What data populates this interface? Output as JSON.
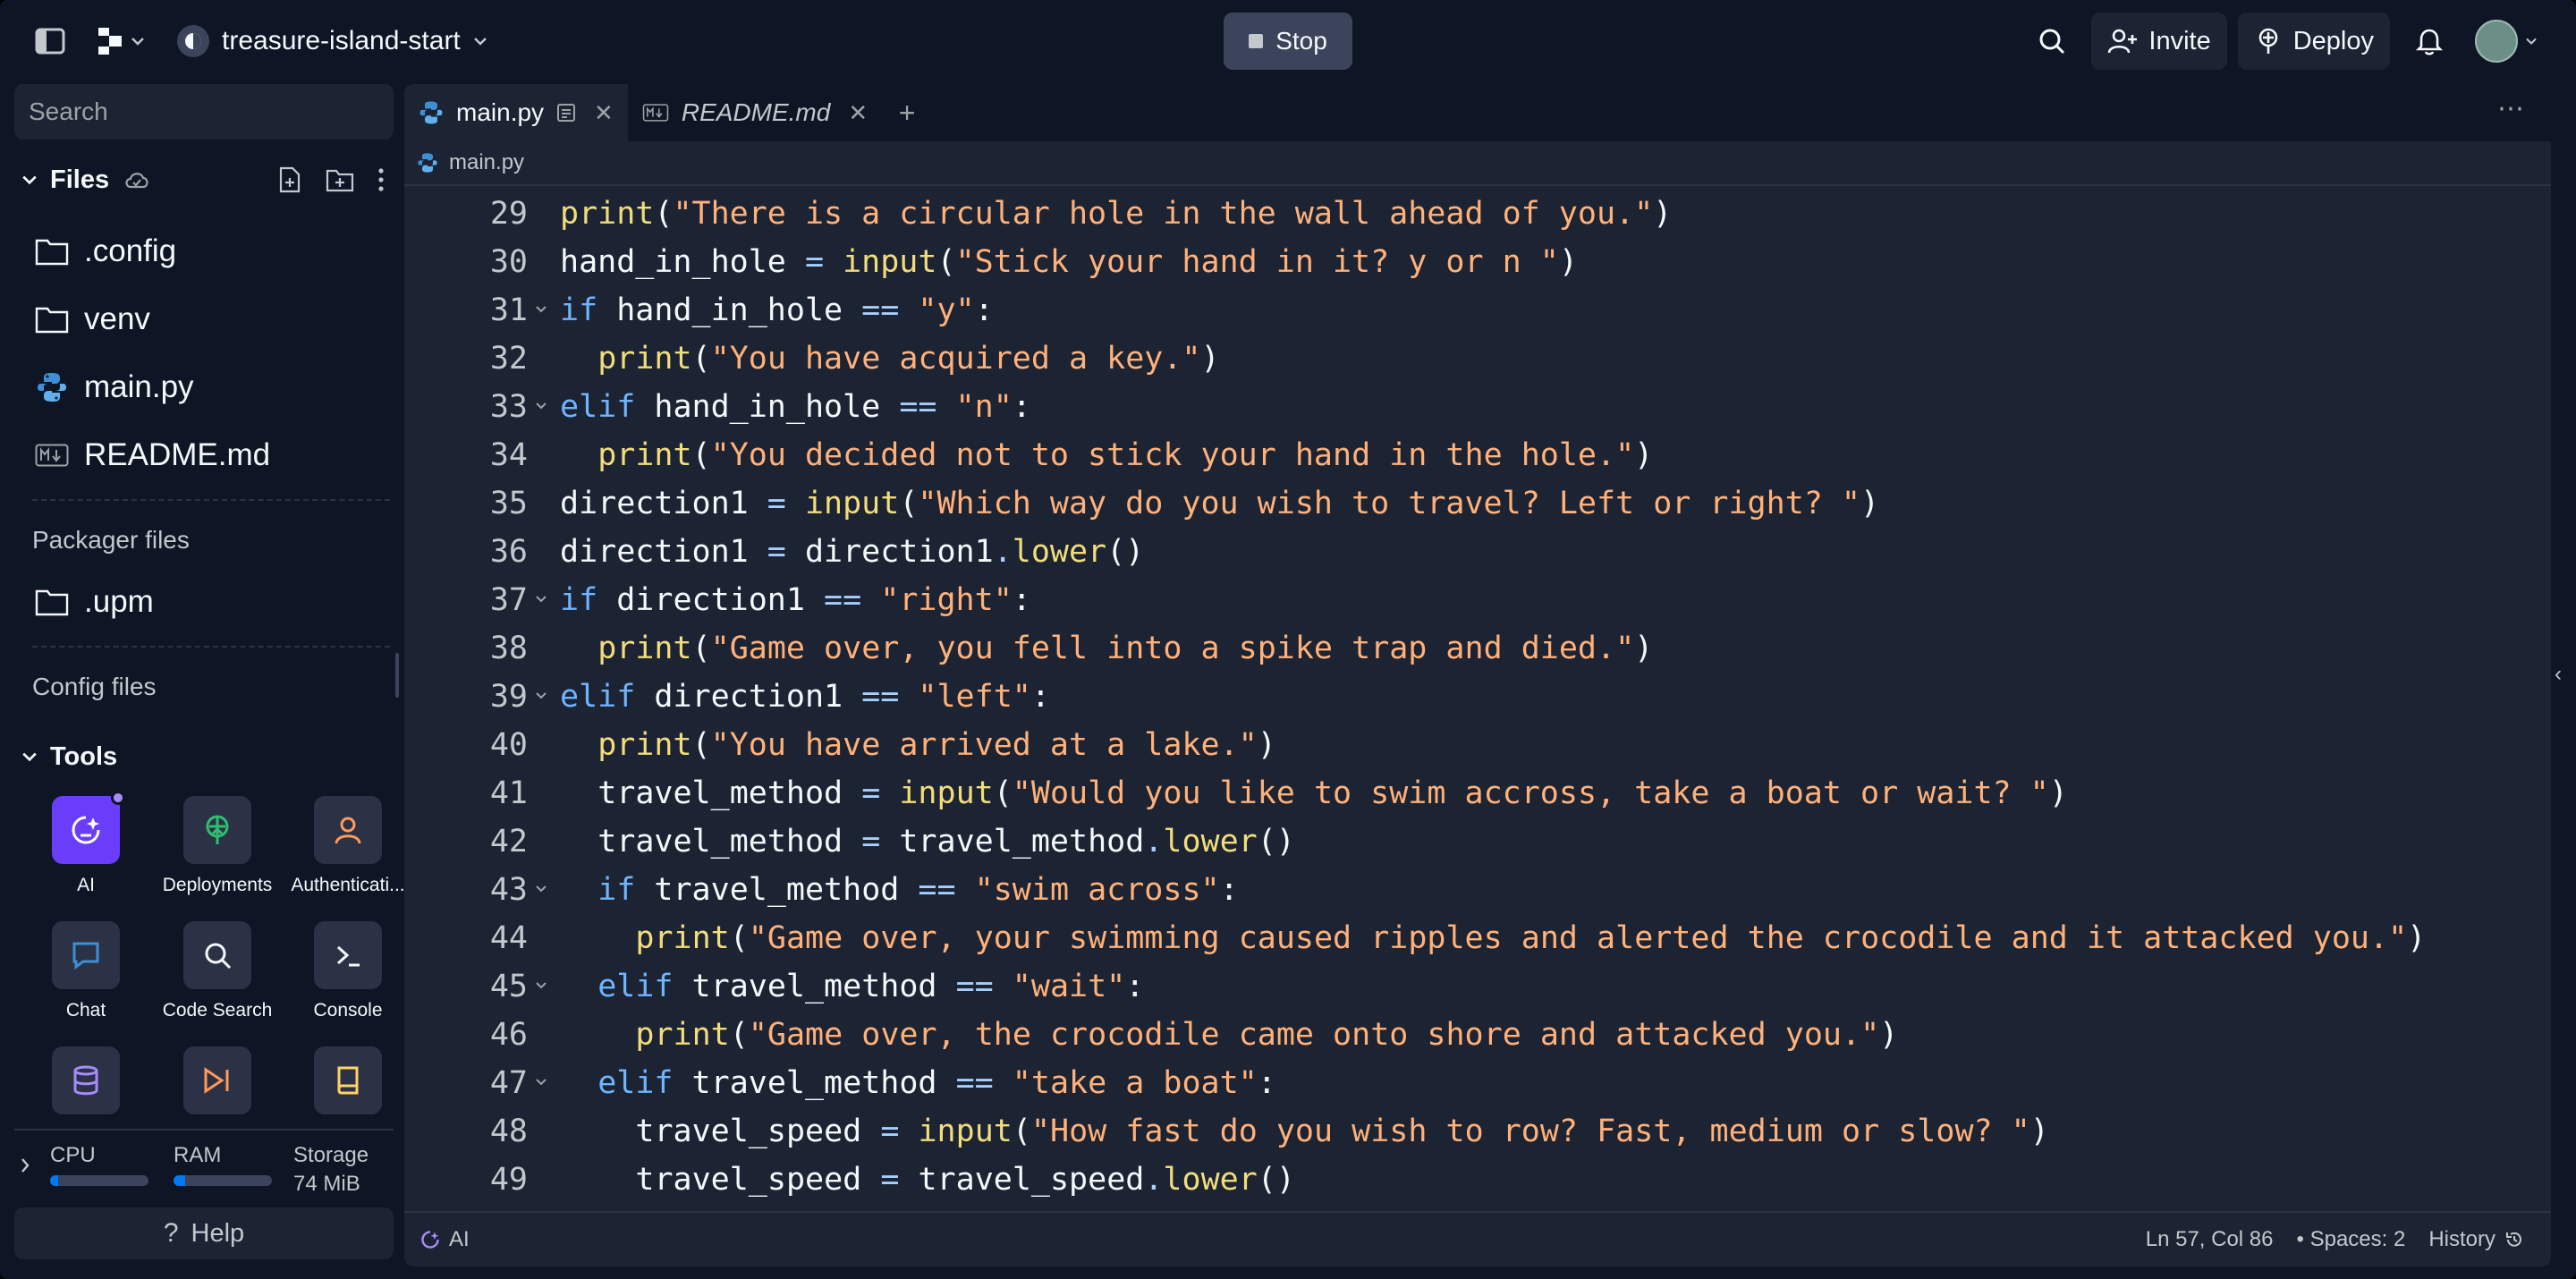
{
  "header": {
    "repl_name": "treasure-island-start",
    "stop_label": "Stop",
    "invite_label": "Invite",
    "deploy_label": "Deploy"
  },
  "sidebar": {
    "search_placeholder": "Search",
    "files_label": "Files",
    "files": [
      {
        "name": ".config",
        "icon": "folder-icon"
      },
      {
        "name": "venv",
        "icon": "folder-icon"
      },
      {
        "name": "main.py",
        "icon": "python-icon"
      },
      {
        "name": "README.md",
        "icon": "markdown-icon"
      }
    ],
    "packager_label": "Packager files",
    "packager_files": [
      {
        "name": ".upm",
        "icon": "folder-icon"
      }
    ],
    "config_label": "Config files",
    "tools_label": "Tools",
    "tools": [
      {
        "name": "AI",
        "icon": "ai-icon"
      },
      {
        "name": "Deployments",
        "icon": "deploy-icon"
      },
      {
        "name": "Authenticati...",
        "icon": "user-icon"
      },
      {
        "name": "Chat",
        "icon": "chat-icon"
      },
      {
        "name": "Code Search",
        "icon": "search-icon"
      },
      {
        "name": "Console",
        "icon": "console-icon"
      },
      {
        "name": "",
        "icon": "database-icon"
      },
      {
        "name": "",
        "icon": "workflow-icon"
      },
      {
        "name": "",
        "icon": "book-icon"
      }
    ],
    "resources": {
      "cpu_label": "CPU",
      "ram_label": "RAM",
      "storage_label": "Storage",
      "storage_value": "74 MiB",
      "cpu_fraction": 0.08,
      "ram_fraction": 0.12
    },
    "help_label": "Help"
  },
  "editor": {
    "tabs": [
      {
        "label": "main.py",
        "active": true
      },
      {
        "label": "README.md",
        "active": false
      }
    ],
    "breadcrumb": "main.py",
    "lines": [
      {
        "n": "29",
        "fold": false,
        "indent": 0,
        "tokens": [
          [
            "fn",
            "print"
          ],
          [
            "p",
            "("
          ],
          [
            "str",
            "\"There is a circular hole in the wall ahead of you.\""
          ],
          [
            "p",
            ")"
          ]
        ]
      },
      {
        "n": "30",
        "fold": false,
        "indent": 0,
        "tokens": [
          [
            "id",
            "hand_in_hole "
          ],
          [
            "op",
            "="
          ],
          [
            "p",
            " "
          ],
          [
            "fn",
            "input"
          ],
          [
            "p",
            "("
          ],
          [
            "str",
            "\"Stick your hand in it? y or n \""
          ],
          [
            "p",
            ")"
          ]
        ]
      },
      {
        "n": "31",
        "fold": true,
        "indent": 0,
        "tokens": [
          [
            "kw",
            "if"
          ],
          [
            "id",
            " hand_in_hole "
          ],
          [
            "op",
            "=="
          ],
          [
            "p",
            " "
          ],
          [
            "str",
            "\"y\""
          ],
          [
            "p",
            ":"
          ]
        ]
      },
      {
        "n": "32",
        "fold": false,
        "indent": 1,
        "tokens": [
          [
            "fn",
            "print"
          ],
          [
            "p",
            "("
          ],
          [
            "str",
            "\"You have acquired a key.\""
          ],
          [
            "p",
            ")"
          ]
        ]
      },
      {
        "n": "33",
        "fold": true,
        "indent": 0,
        "tokens": [
          [
            "kw",
            "elif"
          ],
          [
            "id",
            " hand_in_hole "
          ],
          [
            "op",
            "=="
          ],
          [
            "p",
            " "
          ],
          [
            "str",
            "\"n\""
          ],
          [
            "p",
            ":"
          ]
        ]
      },
      {
        "n": "34",
        "fold": false,
        "indent": 1,
        "tokens": [
          [
            "fn",
            "print"
          ],
          [
            "p",
            "("
          ],
          [
            "str",
            "\"You decided not to stick your hand in the hole.\""
          ],
          [
            "p",
            ")"
          ]
        ]
      },
      {
        "n": "35",
        "fold": false,
        "indent": 0,
        "tokens": [
          [
            "id",
            "direction1 "
          ],
          [
            "op",
            "="
          ],
          [
            "p",
            " "
          ],
          [
            "fn",
            "input"
          ],
          [
            "p",
            "("
          ],
          [
            "str",
            "\"Which way do you wish to travel? Left or right? \""
          ],
          [
            "p",
            ")"
          ]
        ]
      },
      {
        "n": "36",
        "fold": false,
        "indent": 0,
        "tokens": [
          [
            "id",
            "direction1 "
          ],
          [
            "op",
            "="
          ],
          [
            "id",
            " direction1"
          ],
          [
            "op",
            "."
          ],
          [
            "fn",
            "lower"
          ],
          [
            "p",
            "()"
          ]
        ]
      },
      {
        "n": "37",
        "fold": true,
        "indent": 0,
        "tokens": [
          [
            "kw",
            "if"
          ],
          [
            "id",
            " direction1 "
          ],
          [
            "op",
            "=="
          ],
          [
            "p",
            " "
          ],
          [
            "str",
            "\"right\""
          ],
          [
            "p",
            ":"
          ]
        ]
      },
      {
        "n": "38",
        "fold": false,
        "indent": 1,
        "tokens": [
          [
            "fn",
            "print"
          ],
          [
            "p",
            "("
          ],
          [
            "str",
            "\"Game over, you fell into a spike trap and died.\""
          ],
          [
            "p",
            ")"
          ]
        ]
      },
      {
        "n": "39",
        "fold": true,
        "indent": 0,
        "tokens": [
          [
            "kw",
            "elif"
          ],
          [
            "id",
            " direction1 "
          ],
          [
            "op",
            "=="
          ],
          [
            "p",
            " "
          ],
          [
            "str",
            "\"left\""
          ],
          [
            "p",
            ":"
          ]
        ]
      },
      {
        "n": "40",
        "fold": false,
        "indent": 1,
        "tokens": [
          [
            "fn",
            "print"
          ],
          [
            "p",
            "("
          ],
          [
            "str",
            "\"You have arrived at a lake.\""
          ],
          [
            "p",
            ")"
          ]
        ]
      },
      {
        "n": "41",
        "fold": false,
        "indent": 1,
        "tokens": [
          [
            "id",
            "travel_method "
          ],
          [
            "op",
            "="
          ],
          [
            "p",
            " "
          ],
          [
            "fn",
            "input"
          ],
          [
            "p",
            "("
          ],
          [
            "str",
            "\"Would you like to swim accross, take a boat or wait? \""
          ],
          [
            "p",
            ")"
          ]
        ]
      },
      {
        "n": "42",
        "fold": false,
        "indent": 1,
        "tokens": [
          [
            "id",
            "travel_method "
          ],
          [
            "op",
            "="
          ],
          [
            "id",
            " travel_method"
          ],
          [
            "op",
            "."
          ],
          [
            "fn",
            "lower"
          ],
          [
            "p",
            "()"
          ]
        ]
      },
      {
        "n": "43",
        "fold": true,
        "indent": 1,
        "tokens": [
          [
            "kw",
            "if"
          ],
          [
            "id",
            " travel_method "
          ],
          [
            "op",
            "=="
          ],
          [
            "p",
            " "
          ],
          [
            "str",
            "\"swim across\""
          ],
          [
            "p",
            ":"
          ]
        ]
      },
      {
        "n": "44",
        "fold": false,
        "indent": 2,
        "tokens": [
          [
            "fn",
            "print"
          ],
          [
            "p",
            "("
          ],
          [
            "str",
            "\"Game over, your swimming caused ripples and alerted the crocodile and it attacked you.\""
          ],
          [
            "p",
            ")"
          ]
        ]
      },
      {
        "n": "45",
        "fold": true,
        "indent": 1,
        "tokens": [
          [
            "kw",
            "elif"
          ],
          [
            "id",
            " travel_method "
          ],
          [
            "op",
            "=="
          ],
          [
            "p",
            " "
          ],
          [
            "str",
            "\"wait\""
          ],
          [
            "p",
            ":"
          ]
        ]
      },
      {
        "n": "46",
        "fold": false,
        "indent": 2,
        "tokens": [
          [
            "fn",
            "print"
          ],
          [
            "p",
            "("
          ],
          [
            "str",
            "\"Game over, the crocodile came onto shore and attacked you.\""
          ],
          [
            "p",
            ")"
          ]
        ]
      },
      {
        "n": "47",
        "fold": true,
        "indent": 1,
        "tokens": [
          [
            "kw",
            "elif"
          ],
          [
            "id",
            " travel_method "
          ],
          [
            "op",
            "=="
          ],
          [
            "p",
            " "
          ],
          [
            "str",
            "\"take a boat\""
          ],
          [
            "p",
            ":"
          ]
        ]
      },
      {
        "n": "48",
        "fold": false,
        "indent": 2,
        "tokens": [
          [
            "id",
            "travel_speed "
          ],
          [
            "op",
            "="
          ],
          [
            "p",
            " "
          ],
          [
            "fn",
            "input"
          ],
          [
            "p",
            "("
          ],
          [
            "str",
            "\"How fast do you wish to row? Fast, medium or slow? \""
          ],
          [
            "p",
            ")"
          ]
        ]
      },
      {
        "n": "49",
        "fold": false,
        "indent": 2,
        "tokens": [
          [
            "id",
            "travel_speed "
          ],
          [
            "op",
            "="
          ],
          [
            "id",
            " travel_speed"
          ],
          [
            "op",
            "."
          ],
          [
            "fn",
            "lower"
          ],
          [
            "p",
            "()"
          ]
        ]
      }
    ]
  },
  "status": {
    "ai_label": "AI",
    "cursor": "Ln 57, Col 86",
    "spaces": "Spaces: 2",
    "history": "History"
  }
}
